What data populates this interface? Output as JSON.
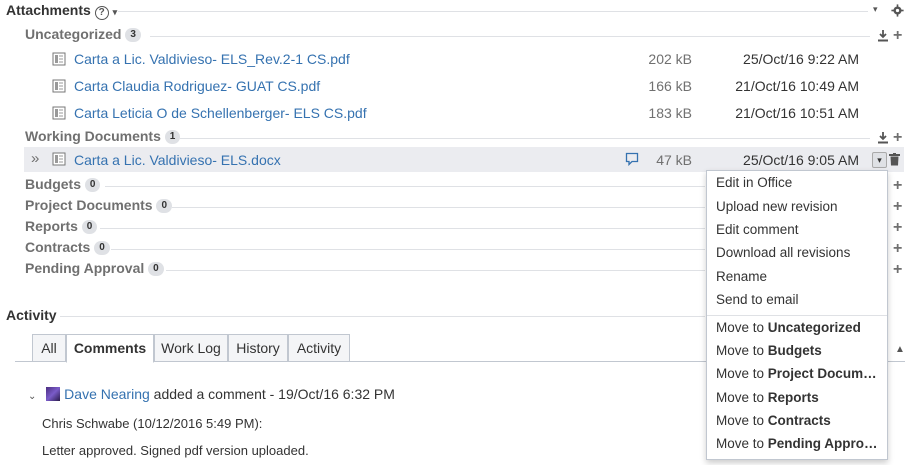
{
  "attachments": {
    "title": "Attachments",
    "help_glyph": "?",
    "categories": [
      {
        "name": "Uncategorized",
        "count": "3",
        "files": [
          {
            "name": "Carta a Lic. Valdivieso- ELS_Rev.2-1 CS.pdf",
            "size": "202 kB",
            "date": "25/Oct/16 9:22 AM"
          },
          {
            "name": "Carta Claudia Rodriguez- GUAT CS.pdf",
            "size": "166 kB",
            "date": "21/Oct/16 10:49 AM"
          },
          {
            "name": "Carta Leticia O de Schellenberger- ELS CS.pdf",
            "size": "183 kB",
            "date": "21/Oct/16 10:51 AM"
          }
        ]
      },
      {
        "name": "Working Documents",
        "count": "1",
        "files": [
          {
            "name": "Carta a Lic. Valdivieso- ELS.docx",
            "size": "47 kB",
            "date": "25/Oct/16 9:05 AM",
            "expander": "»"
          }
        ]
      },
      {
        "name": "Budgets",
        "count": "0"
      },
      {
        "name": "Project Documents",
        "count": "0"
      },
      {
        "name": "Reports",
        "count": "0"
      },
      {
        "name": "Contracts",
        "count": "0"
      },
      {
        "name": "Pending Approval",
        "count": "0"
      }
    ]
  },
  "context_menu": {
    "items": [
      "Edit in Office",
      "Upload new revision",
      "Edit comment",
      "Download all revisions",
      "Rename",
      "Send to email"
    ],
    "move_prefix": "Move to",
    "move_targets": [
      "Uncategorized",
      "Budgets",
      "Project Docum…",
      "Reports",
      "Contracts",
      "Pending Appro…"
    ]
  },
  "activity": {
    "title": "Activity",
    "tabs": [
      "All",
      "Comments",
      "Work Log",
      "History",
      "Activity"
    ],
    "active_tab": "Comments",
    "comment": {
      "author": "Dave Nearing",
      "action": "added a comment - 19/Oct/16 6:32 PM",
      "lines": [
        "Chris Schwabe (10/12/2016 5:49 PM):",
        "Letter approved. Signed pdf version uploaded."
      ]
    }
  },
  "colors": {
    "link": "#3572b0",
    "highlight": "#ebecf0",
    "muted": "#707070"
  }
}
